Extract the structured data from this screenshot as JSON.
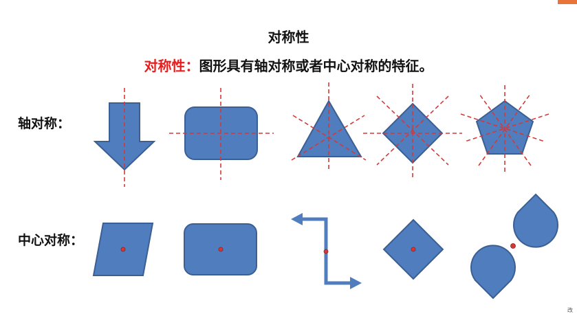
{
  "corner_badge": "",
  "title": "对称性",
  "subtitle": {
    "highlight": "对称性：",
    "rest": "图形具有轴对称或者中心对称的特征。"
  },
  "rows": {
    "axial": {
      "label": "轴对称："
    },
    "central": {
      "label": "中心对称："
    }
  },
  "corner_text": "改",
  "colors": {
    "shape_fill": "#4f7dbd",
    "axis_line": "#d23a3a",
    "highlight_text": "#e81c1c"
  }
}
